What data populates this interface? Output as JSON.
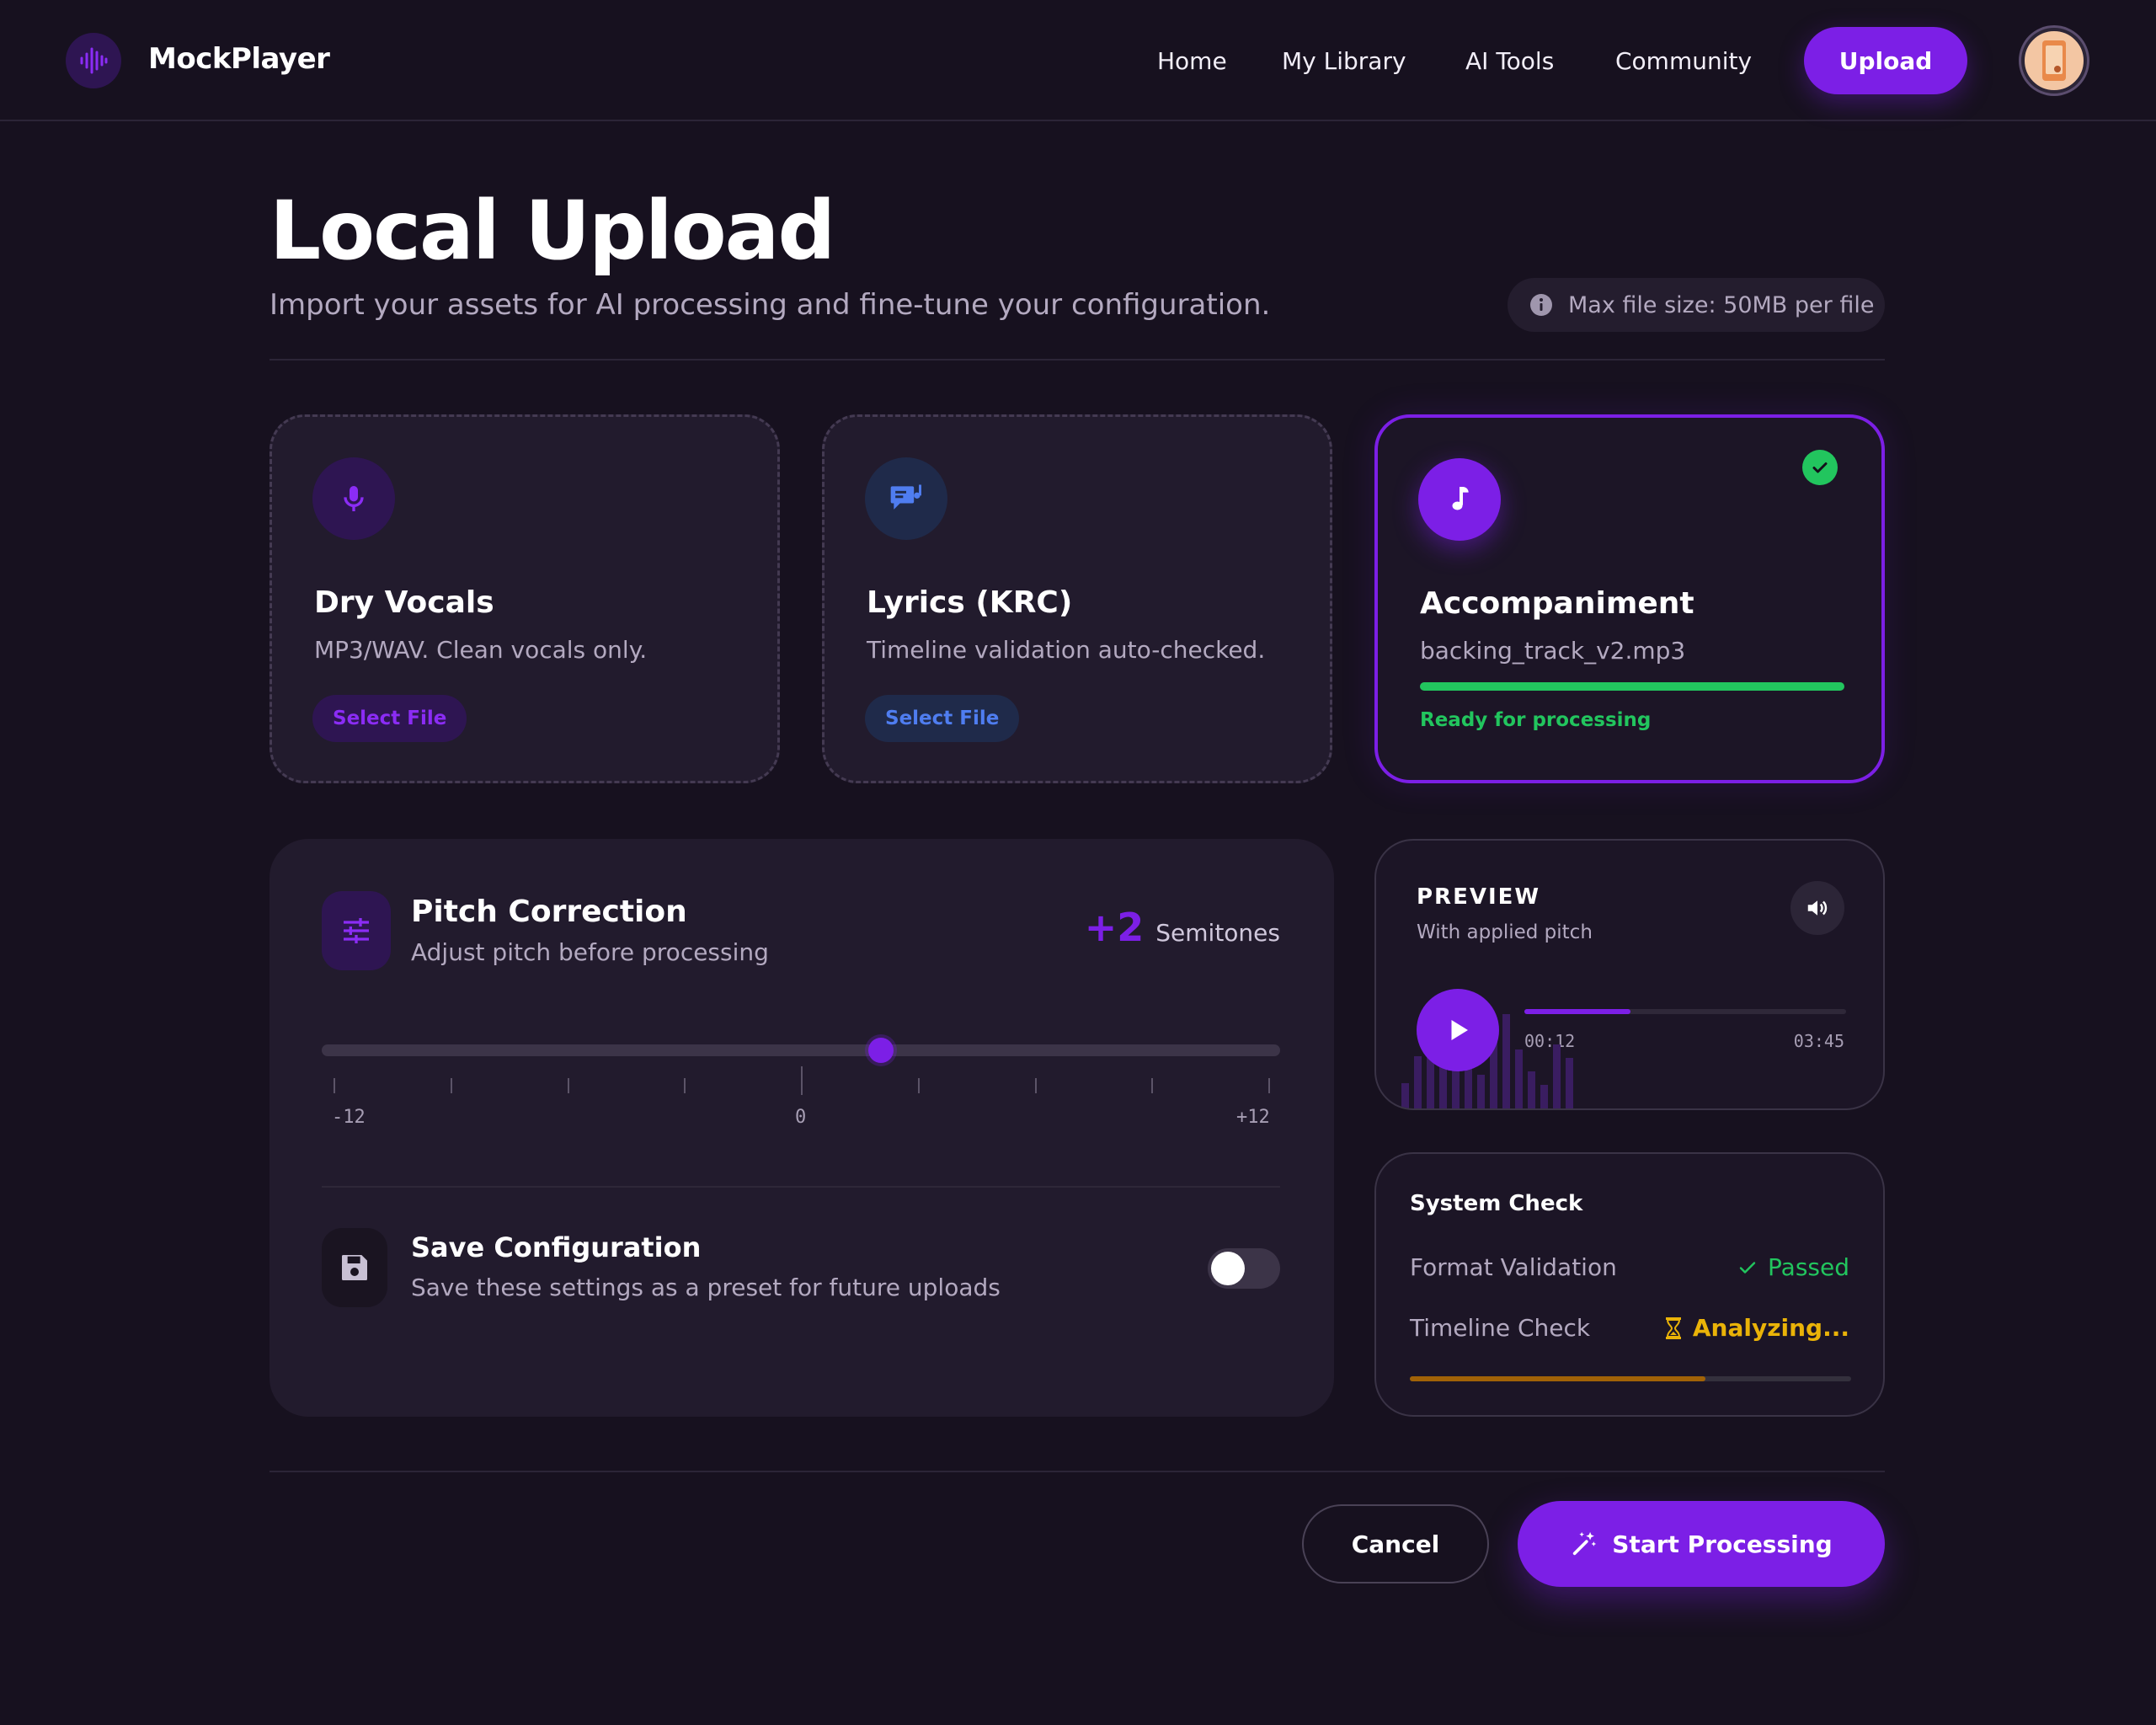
{
  "nav": {
    "brand": "MockPlayer",
    "links": [
      "Home",
      "My Library",
      "AI Tools",
      "Community"
    ],
    "upload_label": "Upload"
  },
  "header": {
    "title": "Local Upload",
    "subtitle": "Import your assets for AI processing and fine-tune your configuration.",
    "info": "Max file size: 50MB per file"
  },
  "cards": [
    {
      "title": "Dry Vocals",
      "desc": "MP3/WAV. Clean vocals only.",
      "button": "Select File",
      "icon": "microphone-icon"
    },
    {
      "title": "Lyrics (KRC)",
      "desc": "Timeline validation auto-checked.",
      "button": "Select File",
      "icon": "lyrics-icon"
    },
    {
      "title": "Accompaniment",
      "filename": "backing_track_v2.mp3",
      "status": "Ready for processing",
      "progress": 1.0,
      "icon": "music-note-icon"
    }
  ],
  "pitch": {
    "title": "Pitch Correction",
    "subtitle": "Adjust pitch before processing",
    "value": "+2",
    "unit": "Semitones",
    "min_label": "-12",
    "mid_label": "0",
    "max_label": "+12",
    "min": -12,
    "max": 12,
    "current": 2
  },
  "save_config": {
    "title": "Save Configuration",
    "subtitle": "Save these settings as a preset for future uploads",
    "enabled": false
  },
  "preview": {
    "label": "PREVIEW",
    "subtitle": "With applied pitch",
    "current_time": "00:12",
    "total_time": "03:45",
    "progress": 0.33
  },
  "system_check": {
    "title": "System Check",
    "rows": [
      {
        "label": "Format Validation",
        "value": "Passed",
        "status": "passed"
      },
      {
        "label": "Timeline Check",
        "value": "Analyzing...",
        "status": "analyzing"
      }
    ],
    "progress": 0.67
  },
  "footer": {
    "cancel_label": "Cancel",
    "start_label": "Start Processing"
  },
  "colors": {
    "accent": "#7c1fe6",
    "success": "#22c55e",
    "warning": "#eab308",
    "background": "#17111f"
  }
}
